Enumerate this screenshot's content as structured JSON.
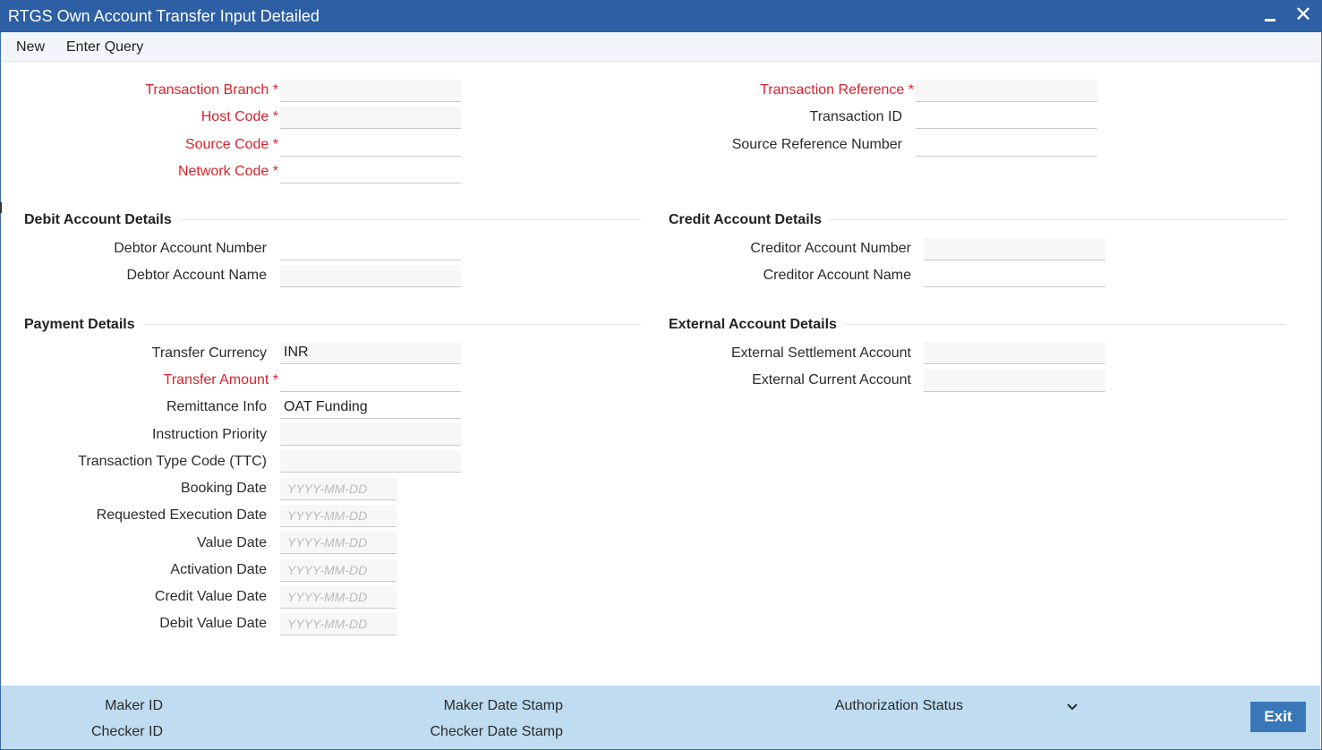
{
  "window": {
    "title": "RTGS Own Account Transfer Input Detailed"
  },
  "menu": {
    "new": "New",
    "enter_query": "Enter Query"
  },
  "header_fields": {
    "transaction_branch": {
      "label": "Transaction Branch *",
      "value": ""
    },
    "host_code": {
      "label": "Host Code *",
      "value": ""
    },
    "source_code": {
      "label": "Source Code *",
      "value": ""
    },
    "network_code": {
      "label": "Network Code *",
      "value": ""
    },
    "transaction_reference": {
      "label": "Transaction Reference *",
      "value": ""
    },
    "transaction_id": {
      "label": "Transaction ID",
      "value": ""
    },
    "source_reference_number": {
      "label": "Source Reference Number",
      "value": ""
    }
  },
  "debit_section": {
    "title": "Debit Account Details",
    "debtor_account_number": {
      "label": "Debtor Account Number",
      "value": ""
    },
    "debtor_account_name": {
      "label": "Debtor Account Name",
      "value": ""
    }
  },
  "credit_section": {
    "title": "Credit Account Details",
    "creditor_account_number": {
      "label": "Creditor Account Number",
      "value": ""
    },
    "creditor_account_name": {
      "label": "Creditor Account Name",
      "value": ""
    }
  },
  "payment_section": {
    "title": "Payment Details",
    "transfer_currency": {
      "label": "Transfer Currency",
      "value": "INR"
    },
    "transfer_amount": {
      "label": "Transfer Amount *",
      "value": ""
    },
    "remittance_info": {
      "label": "Remittance Info",
      "value": "OAT Funding"
    },
    "instruction_priority": {
      "label": "Instruction Priority",
      "value": ""
    },
    "transaction_type_code": {
      "label": "Transaction Type Code (TTC)",
      "value": ""
    },
    "booking_date": {
      "label": "Booking Date",
      "placeholder": "YYYY-MM-DD"
    },
    "requested_execution_date": {
      "label": "Requested Execution Date",
      "placeholder": "YYYY-MM-DD"
    },
    "value_date": {
      "label": "Value Date",
      "placeholder": "YYYY-MM-DD"
    },
    "activation_date": {
      "label": "Activation Date",
      "placeholder": "YYYY-MM-DD"
    },
    "credit_value_date": {
      "label": "Credit Value Date",
      "placeholder": "YYYY-MM-DD"
    },
    "debit_value_date": {
      "label": "Debit Value Date",
      "placeholder": "YYYY-MM-DD"
    }
  },
  "external_section": {
    "title": "External Account Details",
    "external_settlement_account": {
      "label": "External Settlement Account",
      "value": ""
    },
    "external_current_account": {
      "label": "External Current Account",
      "value": ""
    }
  },
  "footer": {
    "maker_id": "Maker ID",
    "checker_id": "Checker ID",
    "maker_date_stamp": "Maker Date Stamp",
    "checker_date_stamp": "Checker Date Stamp",
    "authorization_status": "Authorization Status",
    "exit_label": "Exit"
  },
  "icons": {
    "minimize": "minimize-icon",
    "close": "close-icon",
    "dropdown": "chevron-down-icon"
  },
  "colors": {
    "titlebar": "#2c5fa3",
    "required_label": "#d9232d",
    "footer": "#bfdcf0",
    "exit_button": "#3a77b8"
  }
}
